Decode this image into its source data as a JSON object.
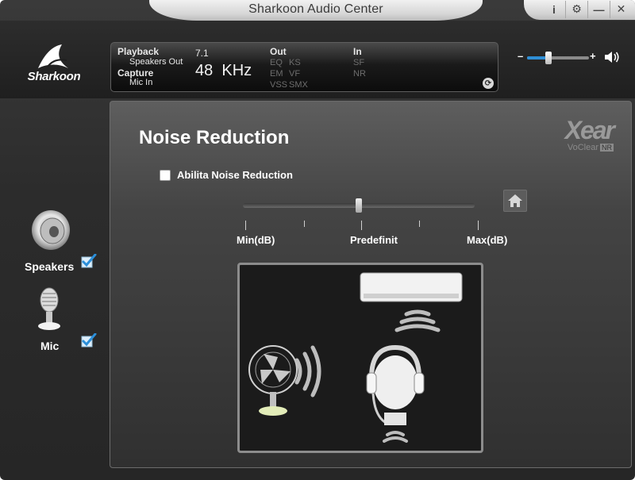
{
  "window": {
    "title": "Sharkoon Audio Center",
    "controls": [
      "i",
      "⚙",
      "—",
      "✕"
    ]
  },
  "brand": {
    "name": "Sharkoon"
  },
  "status": {
    "playback_label": "Playback",
    "playback_device": "Speakers Out",
    "capture_label": "Capture",
    "capture_device": "Mic In",
    "channels": "7.1",
    "sample_rate": "48  KHz",
    "out_label": "Out",
    "out_items": [
      "EQ",
      "KS",
      "EM",
      "VF",
      "VSS",
      "SMX"
    ],
    "in_label": "In",
    "in_items": [
      "SF",
      "NR"
    ]
  },
  "volume": {
    "minus": "–",
    "plus": "+",
    "level": 0.35,
    "accent": "#2f8fd6"
  },
  "devices": [
    {
      "label": "Speakers",
      "checked": true,
      "icon": "speaker-icon"
    },
    {
      "label": "Mic",
      "checked": true,
      "icon": "microphone-icon"
    }
  ],
  "main": {
    "title": "Noise Reduction",
    "xear_logo": "Xear",
    "xear_sub": "VoClear",
    "xear_badge": "NR",
    "enable_label": "Abilita Noise Reduction",
    "enable_checked": false,
    "slider": {
      "position": 0.5,
      "labels": {
        "min": "Min(dB)",
        "mid": "Predefinit",
        "max": "Max(dB)"
      }
    }
  }
}
